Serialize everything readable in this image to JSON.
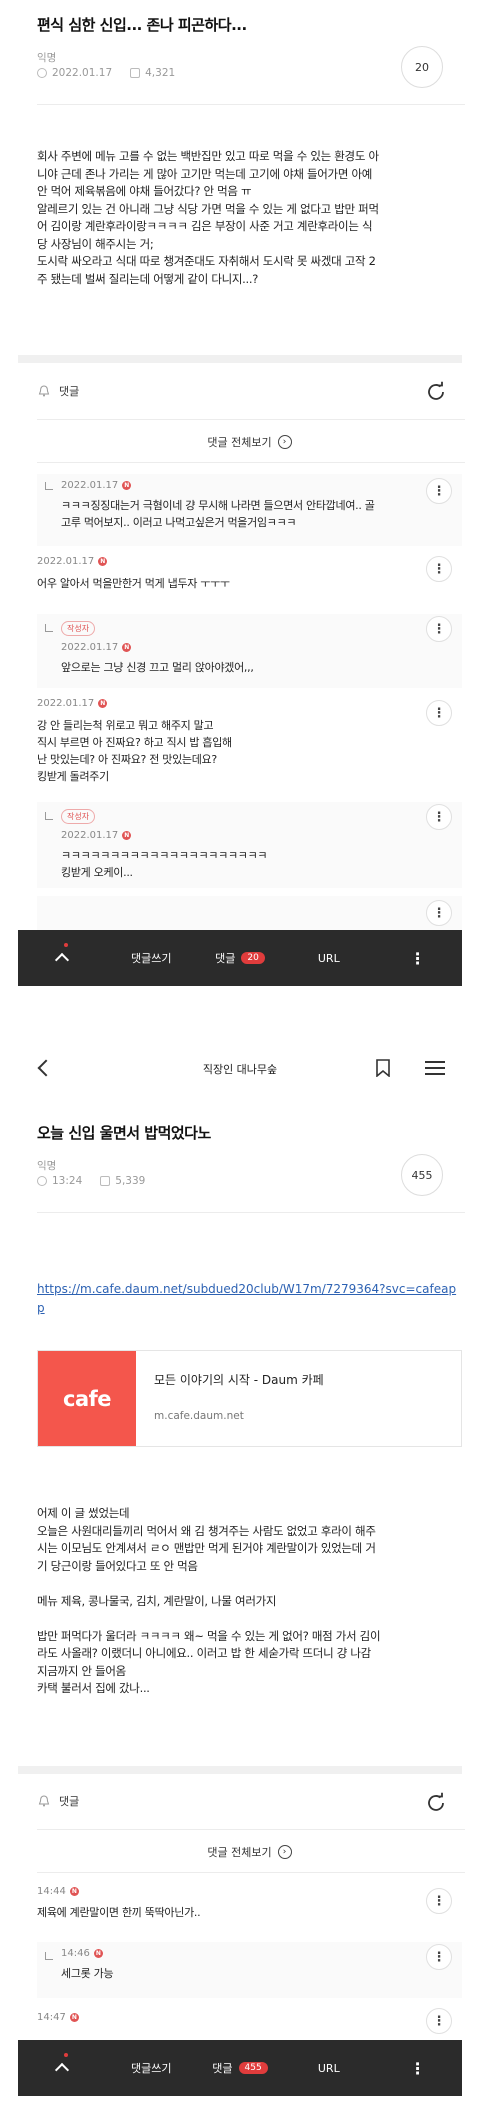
{
  "post1": {
    "title": "편식 심한 신입... 존나 피곤하다...",
    "author": "익명",
    "date": "2022.01.17",
    "views": "4,321",
    "comment_count": "20",
    "body": "회사 주변에 메뉴 고를 수 없는 백반집만 있고 따로 먹을 수 있는 환경도 아\n니야 근데 존나 가리는 게 많아 고기만 먹는데 고기에 야채 들어가면 아예\n안 먹어 제육볶음에 야채 들어갔다? 안 먹음 ㅠ\n알레르기 있는 건 아니래 그냥 식당 가면 먹을 수 있는 게 없다고 밥만 퍼먹\n어 김이랑 계란후라이랑ㅋㅋㅋㅋ 김은 부장이 사준 거고 계란후라이는 식\n당 사장님이 해주시는 거;\n도시락 싸오라고 식대 따로 챙겨준대도 자취해서 도시락 못 싸겠대 고작 2\n주 됐는데 벌써 질리는데 어떻게 같이 다니지...?",
    "comments_label": "댓글",
    "view_all_label": "댓글 전체보기",
    "comments": [
      {
        "date": "2022.01.17",
        "text": "ㅋㅋㅋ징징대는거 극혐이네 걍 무시해 나라면 들으면서 안타깝네여.. 골\n고루 먹어보지.. 이러고 나먹고싶은거 먹을거임ㅋㅋㅋ"
      },
      {
        "date": "2022.01.17",
        "text": "어우 알아서 먹을만한거 먹게 냅두자 ㅜㅜㅜ"
      },
      {
        "tag": "작성자",
        "date": "2022.01.17",
        "text": "앞으로는 그냥 신경 끄고 멀리 앉아야겠어,,,"
      },
      {
        "date": "2022.01.17",
        "text": "강 안 들리는척 위로고 뭐고 해주지 말고\n직시 부르면 아 진짜요? 하고 직시 밥 흡입해\n난 맛있는데? 아 진짜요? 전 맛있는데요?\n킹받게 돌려주기"
      },
      {
        "tag": "작성자",
        "date": "2022.01.17",
        "text": "ㅋㅋㅋㅋㅋㅋㅋㅋㅋㅋㅋㅋㅋㅋㅋㅋㅋㅋㅋㅋㅋ\n킹받게 오케이..."
      }
    ]
  },
  "bottom_bar1": {
    "write_label": "댓글쓰기",
    "comment_label": "댓글",
    "comment_count": "20",
    "url_label": "URL"
  },
  "header2": {
    "cafe_name": "직장인 대나무숲"
  },
  "post2": {
    "title": "오늘 신입 울면서 밥먹었다노",
    "author": "익명",
    "time": "13:24",
    "views": "5,339",
    "comment_count": "455",
    "link_url": "https://m.cafe.daum.net/subdued20club/W17m/7279364?svc=cafeapp",
    "card_logo": "cafe",
    "card_title": "모든 이야기의 시작 - Daum 카페",
    "card_domain": "m.cafe.daum.net",
    "body": "어제 이 글 썼었는데\n오늘은 사원대리들끼리 먹어서 왜 김 챙겨주는 사람도 없었고 후라이 해주\n시는 이모님도 안계셔서 ㄹㅇ 맨밥만 먹게 된거야 계란말이가 있었는데 거\n기 당근이랑 들어있다고 또 안 먹음\n\n메뉴 제육, 콩나물국, 김치, 계란말이, 나물 여러가지\n\n밥만 퍼먹다가 울더라 ㅋㅋㅋㅋ 왜~ 먹을 수 있는 게 없어? 매점 가서 김이\n라도 사올래? 이랬더니 아니에요.. 이러고 밥 한 세숟가락 뜨더니 걍 나감\n지금까지 안 들어옴\n카택 불러서 집에 갔나...",
    "comments_label": "댓글",
    "view_all_label": "댓글 전체보기",
    "comments": [
      {
        "date": "14:44",
        "text": "제육에 계란말이면 한끼 뚝딱아닌가.."
      },
      {
        "date": "14:46",
        "text": "세그롯 가능"
      },
      {
        "date": "14:47",
        "text": ""
      }
    ]
  },
  "bottom_bar2": {
    "write_label": "댓글쓰기",
    "comment_label": "댓글",
    "comment_count": "455",
    "url_label": "URL"
  },
  "colors": {
    "accent_red": "#e03c3c",
    "link_blue": "#2d62b3",
    "bar_dark": "#2b2b2b",
    "cafe_red": "#f4564c"
  }
}
